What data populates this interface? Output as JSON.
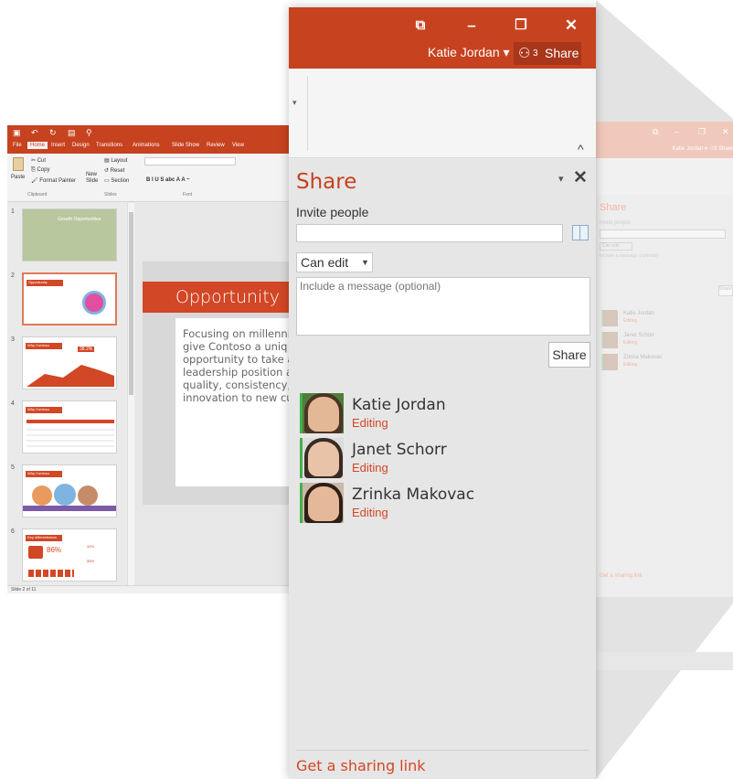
{
  "share_window": {
    "title_controls": {
      "restore": "⧉",
      "minimize": "–",
      "maximize": "❐",
      "close": "✕"
    },
    "user_name": "Katie Jordan ▾",
    "share_button": {
      "icon": "people-icon",
      "count": "3",
      "label": "Share"
    },
    "pane": {
      "title": "Share",
      "dropdown_glyph": "▾",
      "close_glyph": "✕",
      "invite_label": "Invite people",
      "invite_value": "",
      "permission": "Can edit",
      "message_placeholder": "Include a message (optional)",
      "share_label": "Share",
      "people": [
        {
          "name": "Katie Jordan",
          "status": "Editing"
        },
        {
          "name": "Janet Schorr",
          "status": "Editing"
        },
        {
          "name": "Zrinka Makovac",
          "status": "Editing"
        }
      ],
      "sharing_link": "Get a sharing link"
    }
  },
  "ppt_window": {
    "tabs": [
      "File",
      "Home",
      "Insert",
      "Design",
      "Transitions",
      "Animations",
      "Slide Show",
      "Review",
      "View"
    ],
    "active_tab": "Home",
    "ribbon": {
      "cut": "Cut",
      "copy": "Copy",
      "paste": "Paste",
      "format_painter": "Format Painter",
      "new_slide": "New\nSlide",
      "layout": "Layout",
      "reset": "Reset",
      "section": "Section",
      "clipboard": "Clipboard",
      "slides": "Slides",
      "font": "Font"
    },
    "thumbnails": [
      {
        "num": "1",
        "label": "Growth Opportunities"
      },
      {
        "num": "2",
        "label": "Opportunity"
      },
      {
        "num": "3",
        "label": "Why Contoso"
      },
      {
        "num": "4",
        "label": "Why Contoso"
      },
      {
        "num": "5",
        "label": "Why Contoso"
      },
      {
        "num": "6",
        "label": "Key differentiators"
      }
    ],
    "thumb_stats": {
      "pct_a": "38.2%",
      "pct_b": "86%",
      "pct_c": "42%",
      "pct_d": "55%"
    },
    "slide_title": "Opportunity",
    "slide_body": "Focusing on millenni\ngive Contoso a uniq\nopportunity to take a\nleadership position a\nquality, consistency, a\ninnovation to new cu",
    "slide_count": "Slide 2 of 11"
  },
  "bg_window": {
    "user_name": "Katie Jordan ▾",
    "share": "Share",
    "pane_title": "Share",
    "invite_label": "Invite people",
    "permission": "Can edit",
    "message_placeholder": "Include a message (optional)",
    "share_label": "Share",
    "people": [
      {
        "name": "Katie Jordan",
        "status": "Editing"
      },
      {
        "name": "Janet Schorr",
        "status": "Editing"
      },
      {
        "name": "Zrinka Makovac",
        "status": "Editing"
      }
    ],
    "sharing_link": "Get a sharing link"
  },
  "colors": {
    "accent": "#c7421f",
    "status_orange": "#d24726",
    "presence_green": "#43b14a"
  }
}
